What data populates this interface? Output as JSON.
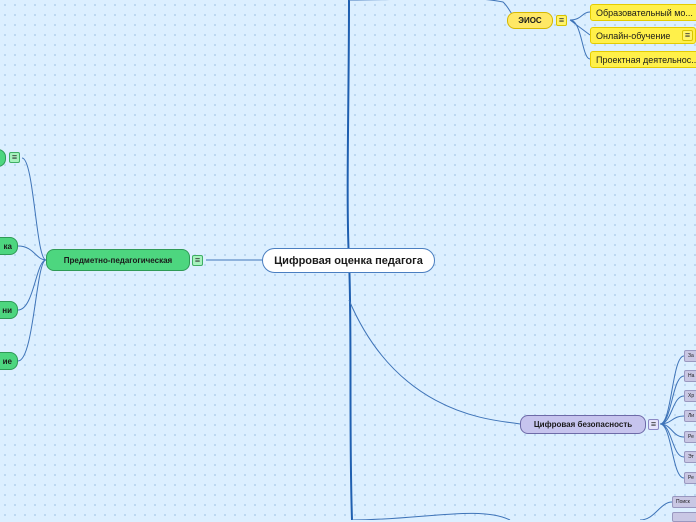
{
  "mindmap": {
    "root": {
      "label": "Цифровая оценка педагога"
    },
    "notes_icon": "≡",
    "branches": {
      "subject": {
        "label": "Предметно-педагогическая",
        "children": [
          "",
          "ка",
          "ни",
          "ие"
        ]
      },
      "eios": {
        "label": "ЭИОС",
        "children": [
          "Образовательный мо...",
          "Онлайн-обучение",
          "Проектная деятельнос..."
        ]
      },
      "security": {
        "label": "Цифровая безопасность",
        "children": [
          "За",
          "На",
          "Хр",
          "Ли",
          "Ре",
          "Эт",
          "Ре"
        ]
      },
      "bottom": {
        "children": [
          "Поиск"
        ]
      }
    }
  },
  "colors": {
    "root_border": "#4a7ec0",
    "green": "#4dd67f",
    "yellow": "#ffe866",
    "lemon": "#fff04a",
    "purple": "#c6c4ee",
    "connector": "#3f74b8",
    "trunk": "#1f5fb0"
  }
}
